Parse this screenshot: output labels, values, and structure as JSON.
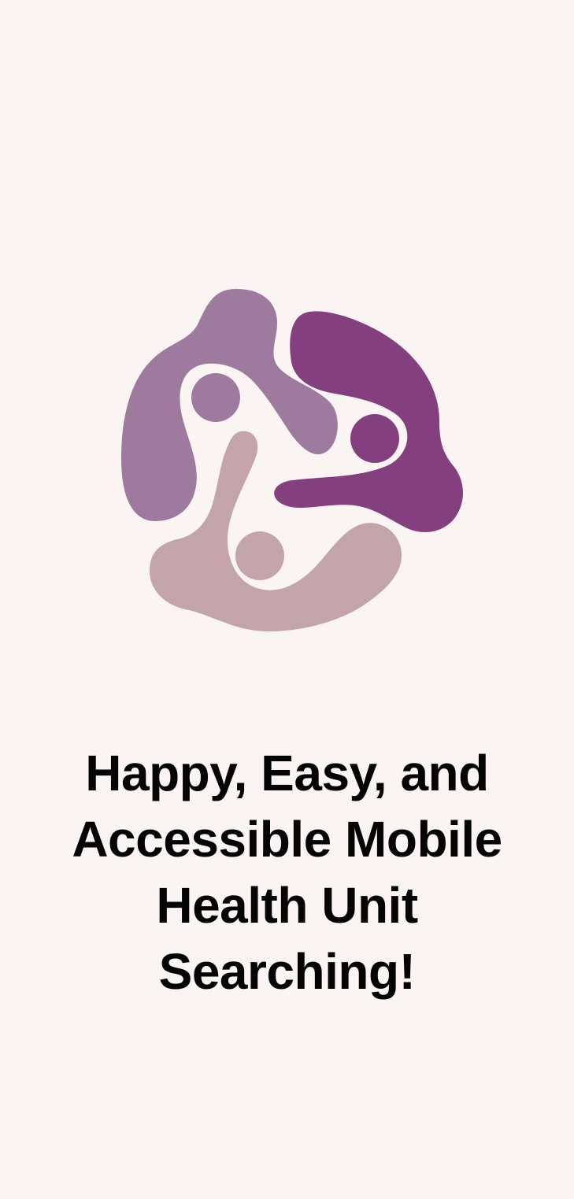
{
  "brand": {
    "logo_icon": "three-figures-circle-logo-icon",
    "colors": {
      "background": "#faf5f2",
      "figure_light_purple": "#9d7a9e",
      "figure_dark_purple": "#843f7f",
      "figure_pink": "#c4a4ab",
      "text": "#050505"
    }
  },
  "tagline": {
    "lines": [
      "Happy, Easy, and",
      "Accessible Mobile",
      "Health Unit",
      "Searching!"
    ]
  }
}
